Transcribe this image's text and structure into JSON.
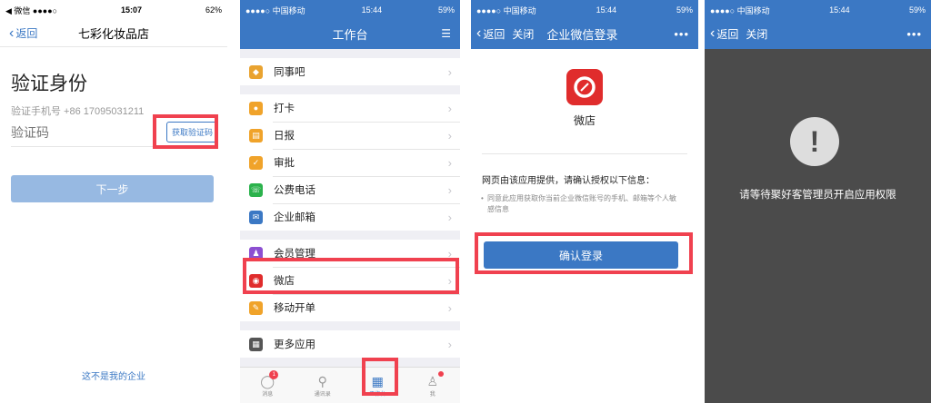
{
  "phone1": {
    "status": {
      "carrier": "◀ 微信 ●●●●○",
      "time": "15:07",
      "battery": "62%"
    },
    "nav": {
      "back": "返回",
      "title": "七彩化妆品店"
    },
    "title": "验证身份",
    "phone_label": "验证手机号 +86 17095031211",
    "code_placeholder": "验证码",
    "get_code": "获取验证码",
    "next": "下一步",
    "not_mine": "这不是我的企业"
  },
  "phone2": {
    "status": {
      "carrier": "●●●●○ 中国移动",
      "time": "15:44",
      "battery": "59%"
    },
    "title": "工作台",
    "sections": [
      [
        {
          "label": "同事吧",
          "icon": "colleague-icon",
          "color": "#e9a330"
        }
      ],
      [
        {
          "label": "打卡",
          "icon": "location-icon",
          "color": "#f0a32a"
        },
        {
          "label": "日报",
          "icon": "daily-report-icon",
          "color": "#f0a32a"
        },
        {
          "label": "审批",
          "icon": "approval-icon",
          "color": "#f0a32a"
        },
        {
          "label": "公费电话",
          "icon": "phone-icon",
          "color": "#2bb24c"
        },
        {
          "label": "企业邮箱",
          "icon": "mail-icon",
          "color": "#3b78c4"
        }
      ],
      [
        {
          "label": "会员管理",
          "icon": "member-icon",
          "color": "#8c4fd1"
        },
        {
          "label": "微店",
          "icon": "weidian-icon",
          "color": "#e02c2c"
        },
        {
          "label": "移动开单",
          "icon": "order-icon",
          "color": "#f0a32a"
        }
      ],
      [
        {
          "label": "更多应用",
          "icon": "grid-icon",
          "color": "#555555"
        }
      ]
    ],
    "tabs": [
      {
        "label": "消息",
        "badge": "1"
      },
      {
        "label": "通讯录"
      },
      {
        "label": "工作台"
      },
      {
        "label": "我"
      }
    ]
  },
  "phone3": {
    "status": {
      "carrier": "●●●●○ 中国移动",
      "time": "15:44",
      "battery": "59%"
    },
    "nav": {
      "back": "返回",
      "close": "关闭",
      "title": "企业微信登录",
      "more": "•••"
    },
    "app_name": "微店",
    "notice": "网页由该应用提供，请确认授权以下信息：",
    "bullet": "同意此应用获取你当前企业微信账号的手机、邮箱等个人敏感信息",
    "confirm": "确认登录"
  },
  "phone4": {
    "status": {
      "carrier": "●●●●○ 中国移动",
      "time": "15:44",
      "battery": "59%"
    },
    "nav": {
      "back": "返回",
      "close": "关闭",
      "more": "•••"
    },
    "message": "请等待聚好客管理员开启应用权限"
  },
  "colors": {
    "accent": "#3b78c4",
    "highlight": "#f0414f",
    "overlay": "#4b4b4b"
  }
}
